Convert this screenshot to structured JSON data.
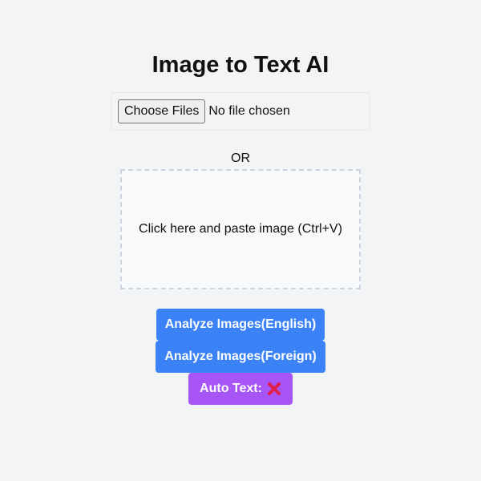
{
  "header": {
    "title": "Image to Text AI"
  },
  "file_input": {
    "button_label": "Choose Files",
    "status": "No file chosen"
  },
  "divider": {
    "text": "OR"
  },
  "paste_area": {
    "text": "Click here and paste image (Ctrl+V)"
  },
  "actions": {
    "analyze_english_label": "Analyze Images(English)",
    "analyze_foreign_label": "Analyze Images(Foreign)",
    "auto_text_label": "Auto Text:",
    "auto_text_state_icon": "red-cross-icon"
  },
  "colors": {
    "primary_button": "#3b82f6",
    "auto_text_button": "#a855f7",
    "background": "#f3f4f6",
    "cross_icon": "#e11d48"
  }
}
